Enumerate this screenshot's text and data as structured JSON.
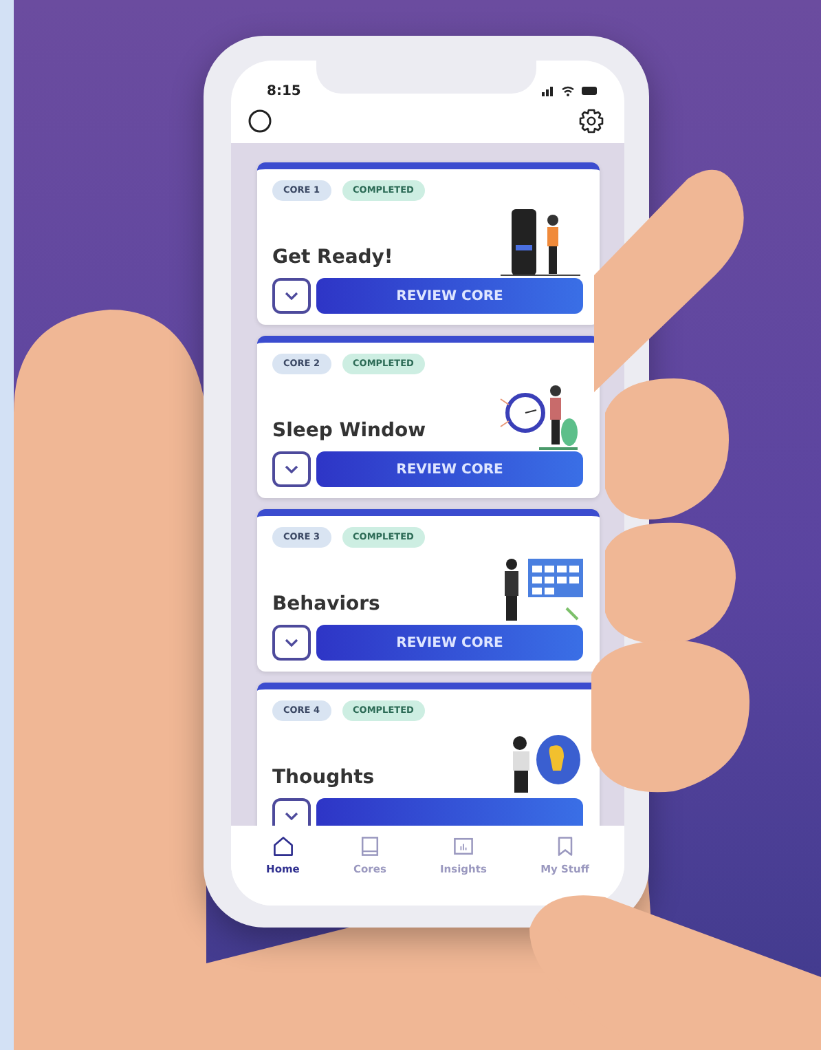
{
  "status_bar": {
    "time": "8:15"
  },
  "cores": [
    {
      "badge": "CORE 1",
      "status": "COMPLETED",
      "title": "Get Ready!",
      "button": "REVIEW CORE"
    },
    {
      "badge": "CORE 2",
      "status": "COMPLETED",
      "title": "Sleep Window",
      "button": "REVIEW CORE"
    },
    {
      "badge": "CORE 3",
      "status": "COMPLETED",
      "title": "Behaviors",
      "button": "REVIEW CORE"
    },
    {
      "badge": "CORE 4",
      "status": "COMPLETED",
      "title": "Thoughts"
    }
  ],
  "nav": [
    {
      "label": "Home",
      "selected": true
    },
    {
      "label": "Cores",
      "selected": false
    },
    {
      "label": "Insights",
      "selected": false
    },
    {
      "label": "My Stuff",
      "selected": false
    }
  ]
}
